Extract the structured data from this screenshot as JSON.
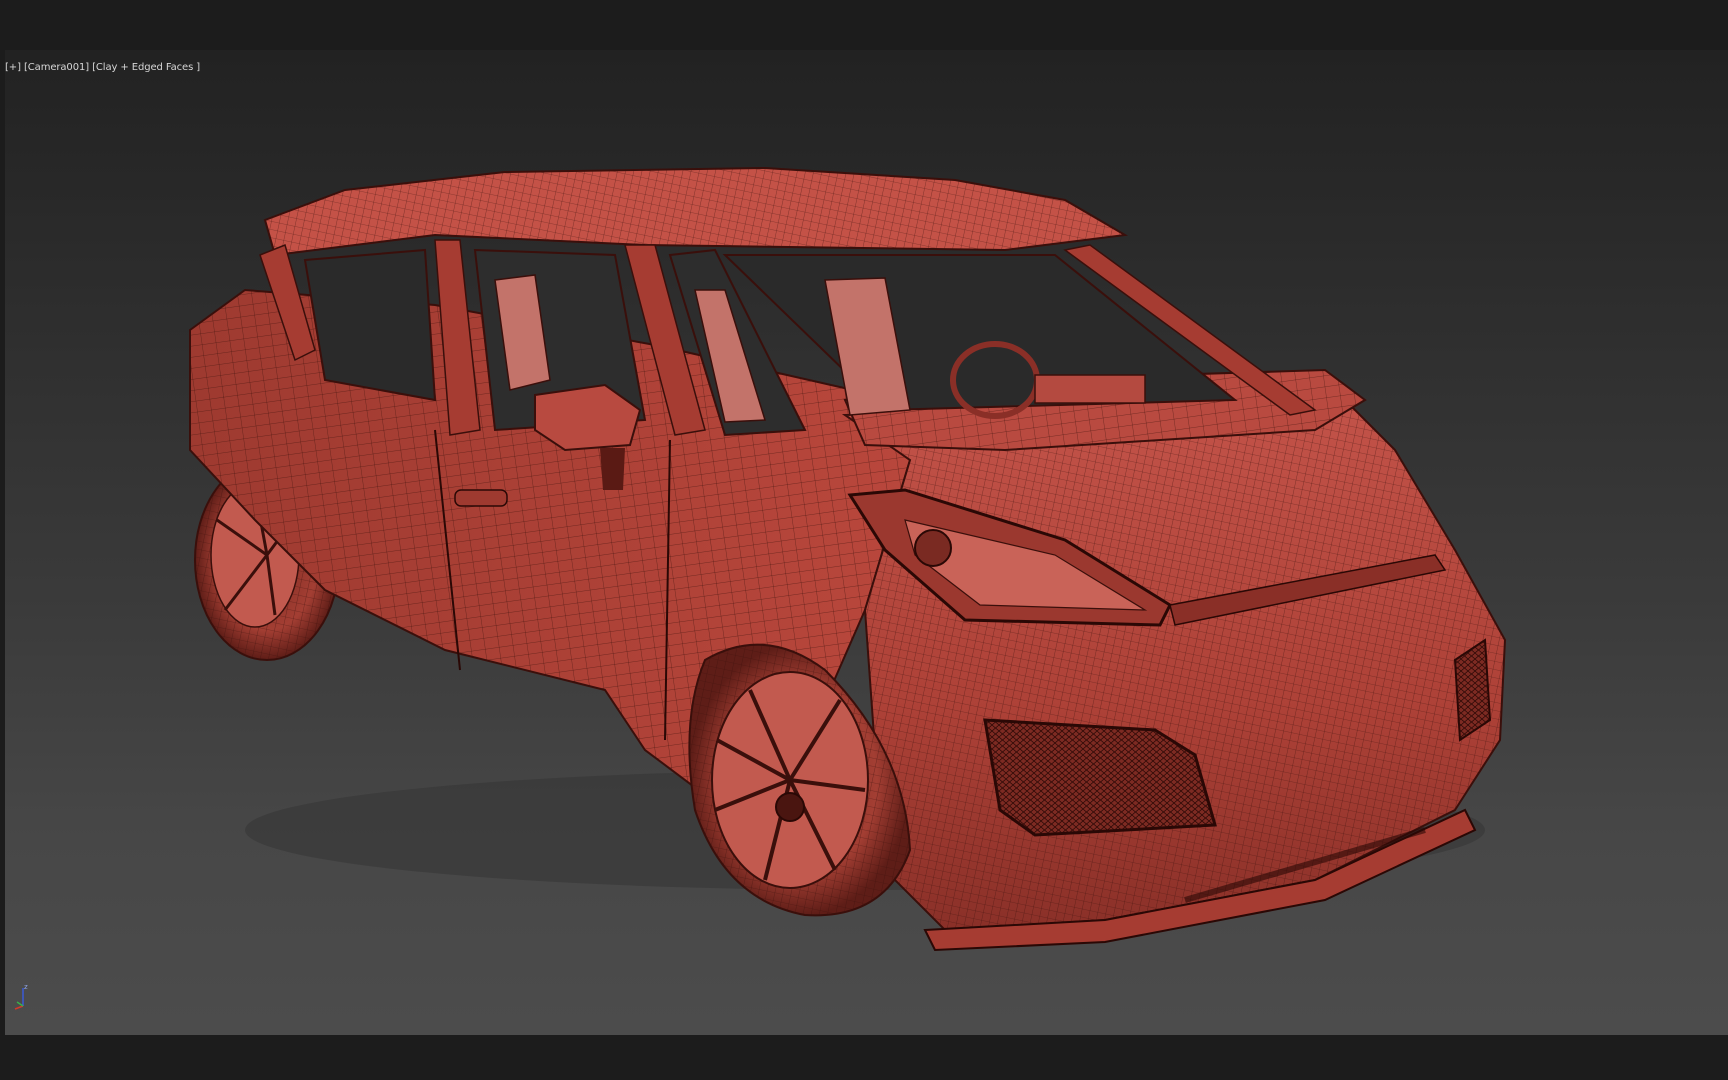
{
  "viewport": {
    "label": {
      "menu": "[+]",
      "camera": "[Camera001]",
      "shading": "[Clay + Edged Faces ]"
    },
    "axis_gizmo": {
      "z_label": "z"
    }
  },
  "colors": {
    "background": "#1c1c1c",
    "viewport_top": "#222222",
    "viewport_bottom": "#4c4c4c",
    "clay": "#b5483d",
    "clay_dark": "#7a2a22",
    "wire": "#3a0f0b",
    "label_text": "#d6d6d6",
    "axis_x": "#d23a2a",
    "axis_y": "#3ab04a",
    "axis_z": "#3a5ad8"
  },
  "scene": {
    "object": "car-model",
    "icon": "car-mesh-icon"
  }
}
